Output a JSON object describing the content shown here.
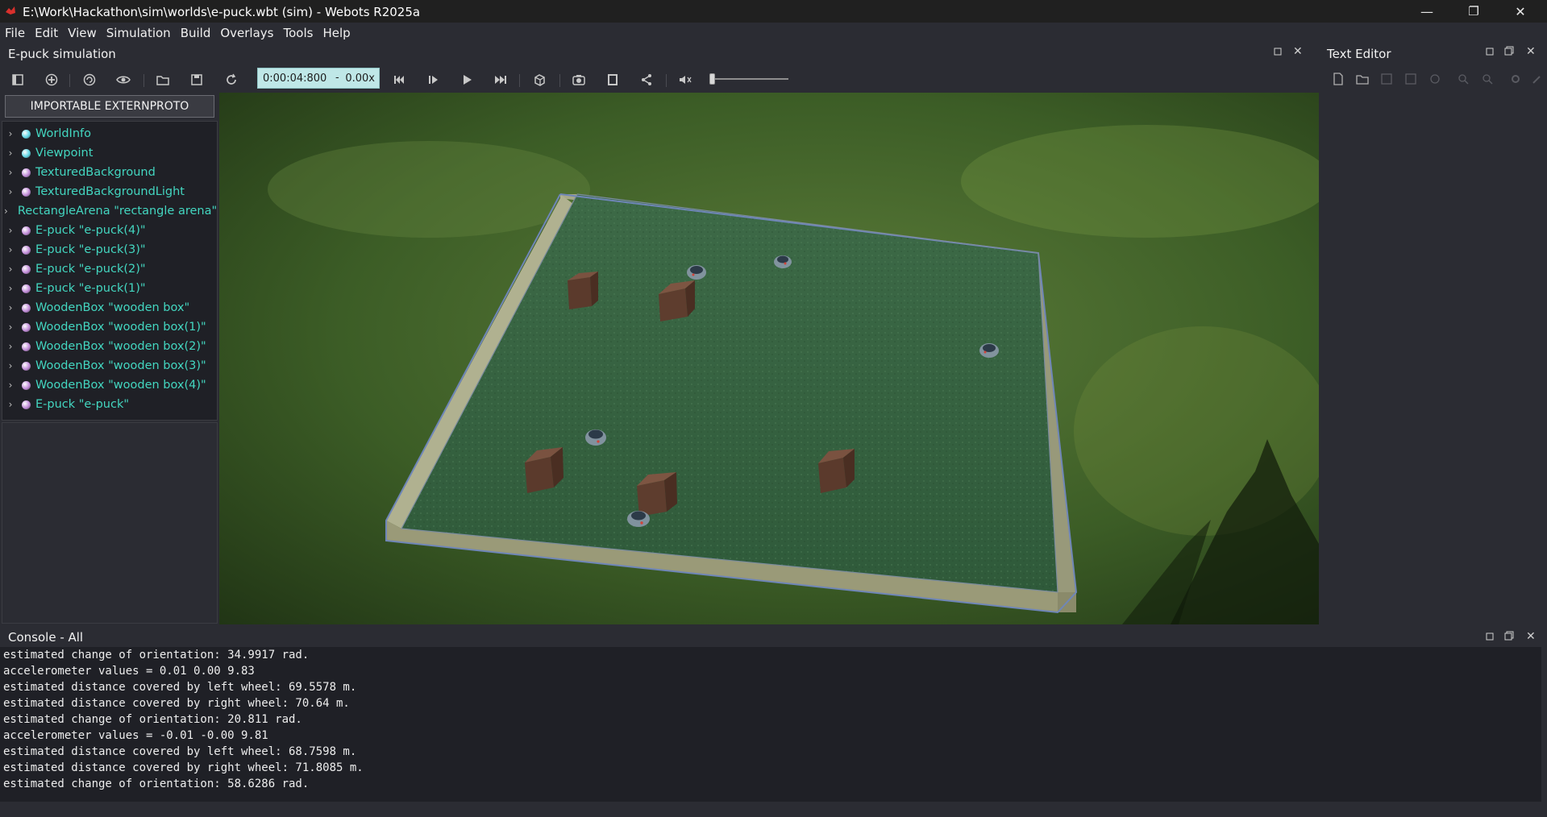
{
  "window": {
    "title": "E:\\Work\\Hackathon\\sim\\worlds\\e-puck.wbt (sim) - Webots R2025a",
    "minimize_symbol": "—",
    "maximize_symbol": "❐",
    "close_symbol": "✕"
  },
  "menu": [
    "File",
    "Edit",
    "View",
    "Simulation",
    "Build",
    "Overlays",
    "Tools",
    "Help"
  ],
  "sim_panel": {
    "title": "E-puck simulation",
    "time": "0:00:04:800",
    "time_separator": "-",
    "speed": "0.00x",
    "speed_level": 0.0,
    "externproto_button": "IMPORTABLE EXTERNPROTO"
  },
  "scene_tree": [
    {
      "label": "WorldInfo",
      "dot": "#5fd7e6"
    },
    {
      "label": "Viewpoint",
      "dot": "#5fd7e6"
    },
    {
      "label": "TexturedBackground",
      "dot": "#c08ad8"
    },
    {
      "label": "TexturedBackgroundLight",
      "dot": "#c08ad8"
    },
    {
      "label": "RectangleArena \"rectangle arena\"",
      "dot": "#c08ad8"
    },
    {
      "label": "E-puck \"e-puck(4)\"",
      "dot": "#c08ad8"
    },
    {
      "label": "E-puck \"e-puck(3)\"",
      "dot": "#c08ad8"
    },
    {
      "label": "E-puck \"e-puck(2)\"",
      "dot": "#c08ad8"
    },
    {
      "label": "E-puck \"e-puck(1)\"",
      "dot": "#c08ad8"
    },
    {
      "label": "WoodenBox \"wooden box\"",
      "dot": "#c08ad8"
    },
    {
      "label": "WoodenBox \"wooden box(1)\"",
      "dot": "#c08ad8"
    },
    {
      "label": "WoodenBox \"wooden box(2)\"",
      "dot": "#c08ad8"
    },
    {
      "label": "WoodenBox \"wooden box(3)\"",
      "dot": "#c08ad8"
    },
    {
      "label": "WoodenBox \"wooden box(4)\"",
      "dot": "#c08ad8"
    },
    {
      "label": "E-puck \"e-puck\"",
      "dot": "#c08ad8"
    }
  ],
  "text_editor": {
    "title": "Text Editor"
  },
  "console": {
    "title": "Console - All",
    "lines": [
      "estimated change of orientation: 34.9917 rad.",
      "accelerometer values = 0.01 0.00 9.83",
      "estimated distance covered by left wheel: 69.5578 m.",
      "estimated distance covered by right wheel: 70.64 m.",
      "estimated change of orientation: 20.811 rad.",
      "accelerometer values = -0.01 -0.00 9.81",
      "estimated distance covered by left wheel: 68.7598 m.",
      "estimated distance covered by right wheel: 71.8085 m.",
      "estimated change of orientation: 58.6286 rad."
    ]
  },
  "colors": {
    "tree_label": "#43d6c0",
    "time_box": "#bfe7e7",
    "grass": "#3f6e45",
    "arena_wall": "#8d9a7a"
  }
}
